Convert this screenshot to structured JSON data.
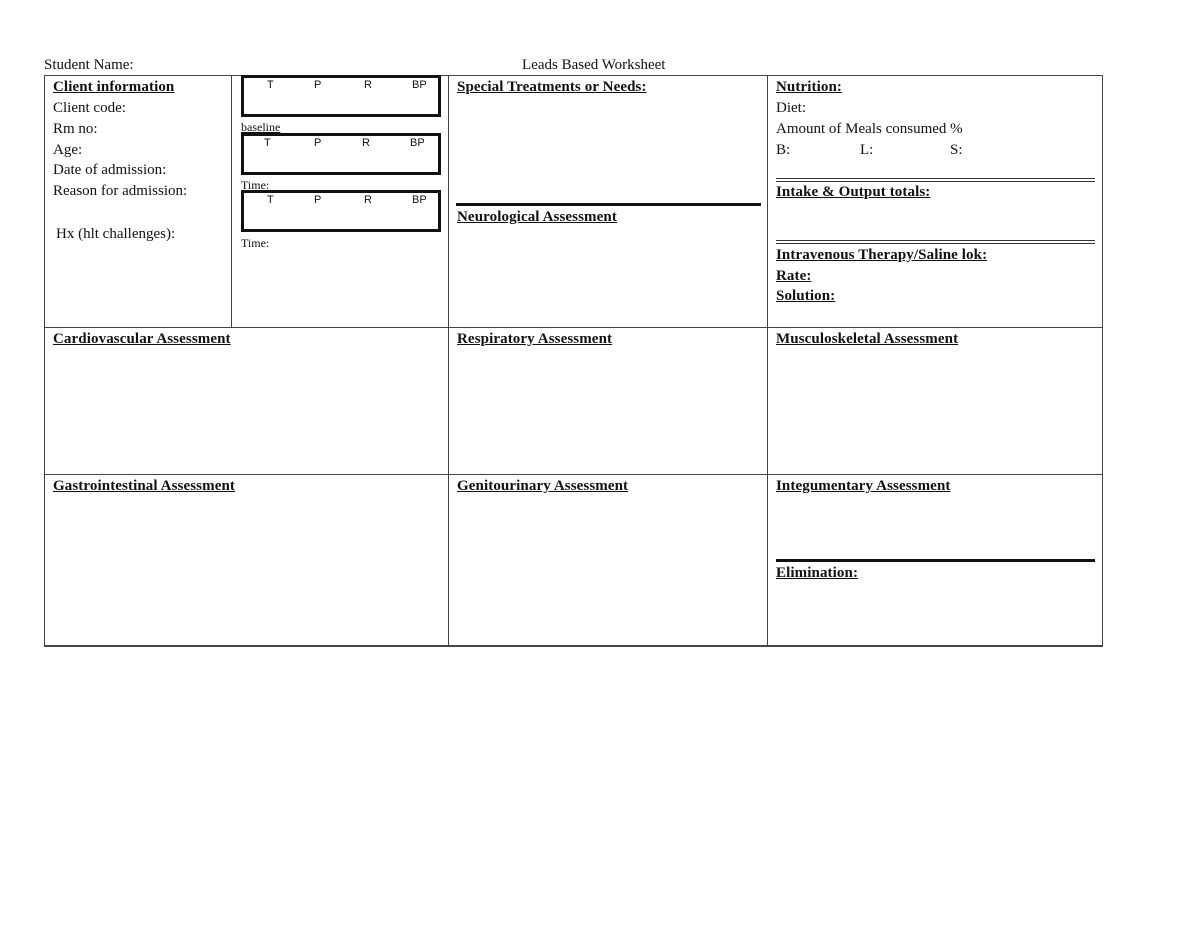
{
  "header": {
    "student_name_label": "Student Name:",
    "title": "Leads Based Worksheet"
  },
  "client_info": {
    "heading": "Client information",
    "fields": [
      "Client code:",
      "Rm no:",
      "Age:",
      "Date of admission:",
      "Reason for admission:"
    ],
    "history_label": "Hx (hlt challenges):"
  },
  "vitals": {
    "columns": [
      "T",
      "P",
      "R",
      "BP"
    ],
    "boxes": [
      {
        "caption": "baseline"
      },
      {
        "caption": "Time:"
      },
      {
        "caption": "Time:"
      }
    ]
  },
  "special": {
    "heading": "Special Treatments or Needs:",
    "neuro_heading": "Neurological Assessment"
  },
  "nutrition": {
    "heading": "Nutrition:",
    "diet_label": "Diet:",
    "meals_label": "Amount of Meals consumed %",
    "meal_b": "B:",
    "meal_l": "L:",
    "meal_s": "S:",
    "io_heading": "Intake & Output totals:",
    "iv_heading": "Intravenous Therapy/Saline lok:",
    "rate_label": "Rate:",
    "solution_label": "Solution:"
  },
  "assessments": {
    "cardiovascular": "Cardiovascular Assessment",
    "respiratory": "Respiratory Assessment",
    "musculoskeletal": "Musculoskeletal Assessment",
    "gastrointestinal": "Gastrointestinal Assessment",
    "genitourinary": "Genitourinary Assessment",
    "integumentary": "Integumentary Assessment",
    "elimination": "Elimination:"
  }
}
